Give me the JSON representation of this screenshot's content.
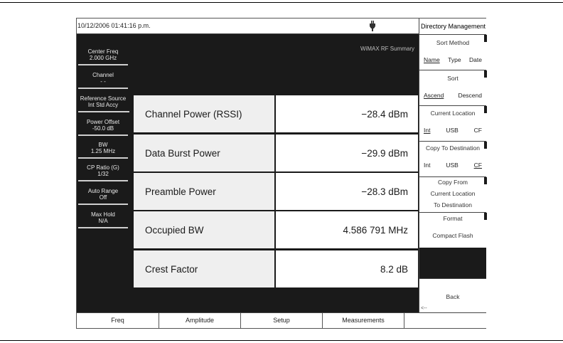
{
  "timestamp": "10/12/2006 01:41:16 p.m.",
  "summary_label": "WiMAX RF Summary",
  "left_params": [
    {
      "label": "Center Freq",
      "value": "2.000 GHz"
    },
    {
      "label": "Channel",
      "value": "- -"
    },
    {
      "label": "Reference Source",
      "value": "Int Std Accy"
    },
    {
      "label": "Power Offset",
      "value": "-50.0 dB"
    },
    {
      "label": "BW",
      "value": "1.25 MHz"
    },
    {
      "label": "CP Ratio (G)",
      "value": "1/32"
    },
    {
      "label": "Auto Range",
      "value": "Off"
    },
    {
      "label": "Max Hold",
      "value": "N/A"
    }
  ],
  "measurements": [
    {
      "name": "Channel Power (RSSI)",
      "value": "−28.4 dBm"
    },
    {
      "name": "Data Burst Power",
      "value": "−29.9 dBm"
    },
    {
      "name": "Preamble Power",
      "value": "−28.3 dBm"
    },
    {
      "name": "Occupied BW",
      "value": "4.586 791 MHz"
    },
    {
      "name": "Crest Factor",
      "value": "8.2 dB"
    }
  ],
  "right_menu": {
    "title": "Directory Management",
    "sort_method": {
      "label": "Sort Method",
      "options": [
        "Name",
        "Type",
        "Date"
      ],
      "selected": "Name"
    },
    "sort": {
      "label": "Sort",
      "options": [
        "Ascend",
        "Descend"
      ],
      "selected": "Ascend"
    },
    "current_location": {
      "label": "Current Location",
      "options": [
        "Int",
        "USB",
        "CF"
      ],
      "selected": "Int"
    },
    "copy_to_destination": {
      "label": "Copy To Destination",
      "options": [
        "Int",
        "USB",
        "CF"
      ],
      "selected": "CF"
    },
    "copy_from": {
      "line1": "Copy From",
      "line2": "Current Location",
      "line3": "To Destination"
    },
    "format": {
      "line1": "Format",
      "line2": "Compact Flash"
    },
    "back": {
      "label": "Back",
      "arrow": "<--"
    }
  },
  "bottom_tabs": [
    "Freq",
    "Amplitude",
    "Setup",
    "Measurements",
    ""
  ],
  "icons": {
    "power": "plug-icon"
  }
}
